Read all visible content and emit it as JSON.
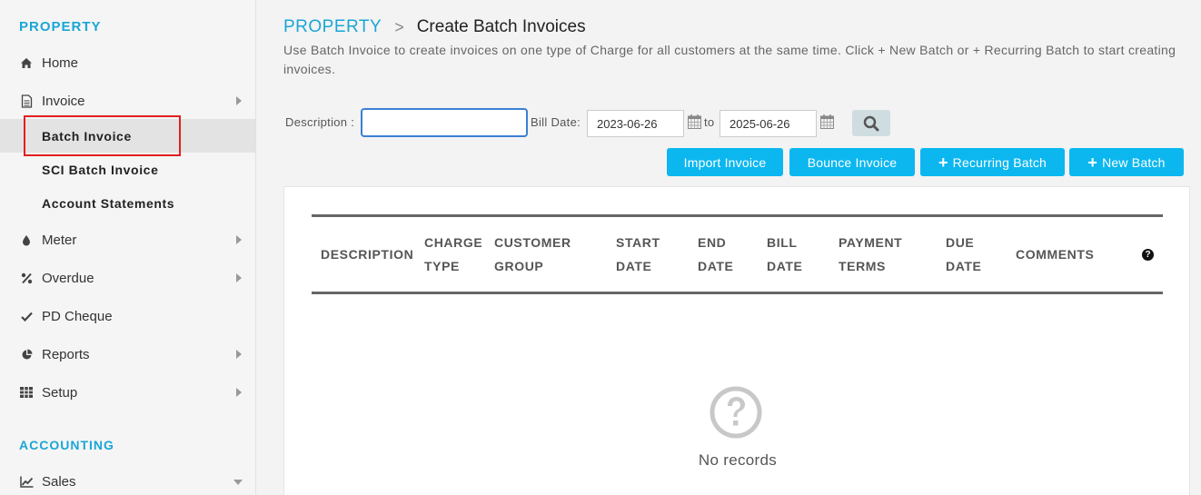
{
  "sidebar": {
    "property_title": "PROPERTY",
    "accounting_title": "ACCOUNTING",
    "items": {
      "home": "Home",
      "invoice": "Invoice",
      "batch_invoice": "Batch Invoice",
      "sci_batch_invoice": "SCI Batch Invoice",
      "account_statements": "Account Statements",
      "meter": "Meter",
      "overdue": "Overdue",
      "pd_cheque": "PD Cheque",
      "reports": "Reports",
      "setup": "Setup",
      "sales": "Sales"
    },
    "icons": {
      "home": "home-icon",
      "invoice": "document-icon",
      "meter": "droplet-icon",
      "overdue": "percent-icon",
      "pd_cheque": "check-icon",
      "reports": "pie-chart-icon",
      "setup": "grid-icon",
      "sales": "line-chart-icon"
    }
  },
  "header": {
    "breadcrumb_root": "PROPERTY",
    "breadcrumb_separator": ">",
    "title": "Create Batch Invoices",
    "intro": "Use Batch Invoice to create invoices on one type of Charge for all customers at the same time. Click + New Batch or + Recurring Batch to start creating invoices."
  },
  "filters": {
    "description_label": "Description :",
    "description_value": "",
    "bill_date_label": "Bill Date:",
    "date_from": "2023-06-26",
    "to_label": "to",
    "date_to": "2025-06-26"
  },
  "buttons": {
    "import_invoice": "Import Invoice",
    "bounce_invoice": "Bounce Invoice",
    "recurring_batch": "Recurring Batch",
    "new_batch": "New Batch",
    "plus": "+"
  },
  "table": {
    "columns": [
      [
        "DESCRIPTION"
      ],
      [
        "CHARGE",
        "TYPE"
      ],
      [
        "CUSTOMER",
        "GROUP"
      ],
      [
        "START",
        "DATE"
      ],
      [
        "END",
        "DATE"
      ],
      [
        "BILL",
        "DATE"
      ],
      [
        "PAYMENT",
        "TERMS"
      ],
      [
        "DUE",
        "DATE"
      ],
      [
        "COMMENTS"
      ]
    ],
    "help_glyph": "?",
    "empty_message": "No records"
  },
  "colors": {
    "accent": "#1aa6d6",
    "button": "#0cb7ef",
    "highlight": "#e02020",
    "input_focus": "#3b7fd4"
  }
}
